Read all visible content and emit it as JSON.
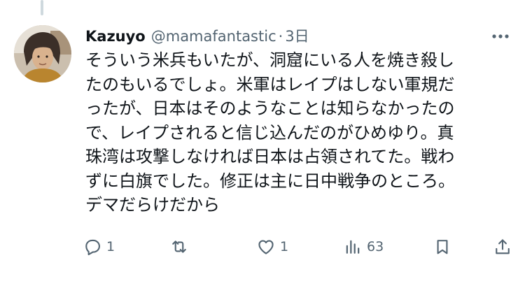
{
  "tweet": {
    "author": {
      "display_name": "Kazuyo",
      "handle": "@mamafantastic",
      "separator": "·",
      "time": "3日"
    },
    "text_lines": [
      "そういう米兵もいたが、洞窟にいる人を焼き殺し",
      "たのもいるでしょ。米軍はレイプはしない軍規だ",
      "ったが、日本はそのようなことは知らなかったの",
      "で、レイプされると信じ込んだのがひめゆり。真",
      "珠湾は攻撃しなければ日本は占領されてた。戦わ",
      "ずに白旗でした。修正は主に日中戦争のところ。",
      "デマだらけだから"
    ],
    "actions": {
      "reply_count": "1",
      "retweet_count": "",
      "like_count": "1",
      "views_count": "63"
    }
  },
  "icons": {
    "reply": "reply-icon",
    "retweet": "retweet-icon",
    "like": "heart-icon",
    "views": "views-icon",
    "bookmark": "bookmark-icon",
    "share": "share-icon",
    "more": "more-icon"
  },
  "colors": {
    "text": "#0f1419",
    "secondary": "#536471",
    "thread_line": "#cfd9de"
  }
}
